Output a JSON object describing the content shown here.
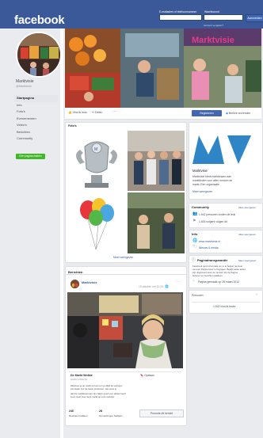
{
  "topbar": {
    "logo": "facebook",
    "email_label": "E-mailadres of telefoonnummer",
    "password_label": "Wachtwoord",
    "login_button": "Aanmelden",
    "forgot": "Account vergeten?"
  },
  "profile": {
    "name": "Marktvisie",
    "handle": "@Marktvisie"
  },
  "sidebar": {
    "items": [
      {
        "label": "Startpagina",
        "active": true
      },
      {
        "label": "Info",
        "active": false
      },
      {
        "label": "Foto's",
        "active": false
      },
      {
        "label": "Evenementen",
        "active": false
      },
      {
        "label": "Video's",
        "active": false
      },
      {
        "label": "Berichten",
        "active": false
      },
      {
        "label": "Community",
        "active": false
      }
    ],
    "create_button": "Een pagina maken"
  },
  "actions": {
    "like": "Vind ik leuk",
    "share": "Delen",
    "more": "···",
    "register": "Registreren",
    "message": "Bericht verzenden"
  },
  "photos_section": {
    "title": "Foto's",
    "more_link": "Meer weergeven"
  },
  "about_card": {
    "brand_text": "MV",
    "name": "Marktvisie",
    "description_line1": "Marktvisie biedt marktkraam aan",
    "description_line2": "marktlieden voor alles rondom de",
    "description_line3": "markt. Een organisatie",
    "more_link": "Meer weergeven"
  },
  "community_card": {
    "title": "Community",
    "see_all": "Alles weergeven",
    "likes": "1.542 personen vinden dit leuk",
    "follows": "1.603 volgers volgen dit"
  },
  "info_card": {
    "title": "Info",
    "see_all": "Alles weergeven",
    "website": "www.marktvisie.nl",
    "category": "Nieuws & media"
  },
  "transparency_card": {
    "title": "Paginatransparantie",
    "see_all": "Meer weergeven",
    "line1": "Facebook toont informatie om je te helpen het doel",
    "line2": "van een Pagina beter te begrijpen. Bekijk welke acties",
    "line3": "zijn uitgevoerd door de mensen die de Pagina",
    "line4": "beheren en berichten plaatsen.",
    "created": "Pagina gemaakt op 28 maart 2012"
  },
  "people_card": {
    "title": "Personen",
    "likes": "1.542 vind-ik-leuks"
  },
  "posts": {
    "section_title": "Berichten",
    "post": {
      "author": "Marktvisie",
      "time": "15 oktober om 12:23",
      "more": "···",
      "link_title": "De Markt Wolkie",
      "link_subtitle": "MARKTVISIE.NL",
      "body_line1": "Wanneer je de markt op komt en je altijd de verkoper",
      "body_line2": "ziet staan met de beste producten, dan weet je",
      "body_line3": "dat die marktkoopman zijn zaken goed voor elkaar heeft.",
      "body_line4": "Lees meer over deze markt op onze website.",
      "save_link": "Opslaan",
      "stats": [
        {
          "count": "246",
          "label": "Reacties bekijken"
        },
        {
          "count": "28",
          "label": "Opmerkingen bekijken"
        }
      ],
      "share_button": "Promote dit bericht"
    }
  },
  "colors": {
    "brand": "#3b5998",
    "link": "#385898",
    "green": "#42b72a",
    "page_bg": "#e9ebee"
  }
}
